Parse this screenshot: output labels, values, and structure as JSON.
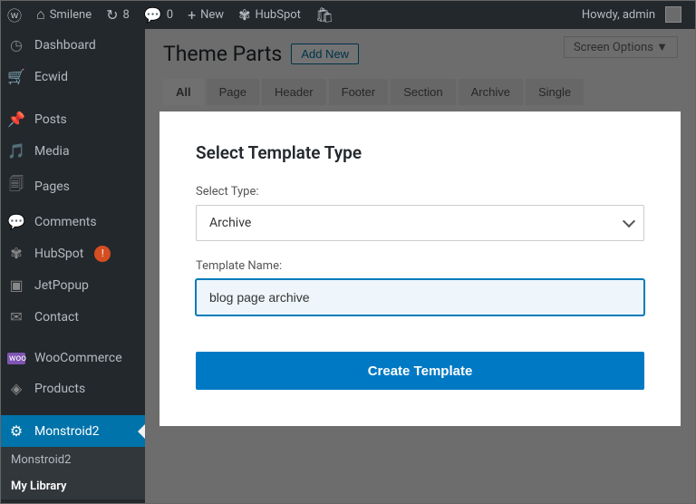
{
  "adminbar": {
    "site_name": "Smilene",
    "updates_count": "8",
    "comments_count": "0",
    "new_label": "New",
    "hubspot_label": "HubSpot",
    "greeting": "Howdy, admin"
  },
  "sidebar": {
    "items": [
      {
        "label": "Dashboard"
      },
      {
        "label": "Ecwid"
      },
      {
        "label": "Posts"
      },
      {
        "label": "Media"
      },
      {
        "label": "Pages"
      },
      {
        "label": "Comments"
      },
      {
        "label": "HubSpot"
      },
      {
        "label": "JetPopup"
      },
      {
        "label": "Contact"
      },
      {
        "label": "WooCommerce"
      },
      {
        "label": "Products"
      },
      {
        "label": "Monstroid2"
      }
    ],
    "hubspot_notif": "!",
    "submenu": [
      "Monstroid2",
      "My Library"
    ]
  },
  "content": {
    "screen_options": "Screen Options ▼",
    "page_title": "Theme Parts",
    "add_new": "Add New",
    "tabs": [
      "All",
      "Page",
      "Header",
      "Footer",
      "Section",
      "Archive",
      "Single"
    ]
  },
  "modal": {
    "title": "Select Template Type",
    "select_label": "Select Type:",
    "select_value": "Archive",
    "name_label": "Template Name:",
    "name_value": "blog page archive",
    "button": "Create Template"
  }
}
